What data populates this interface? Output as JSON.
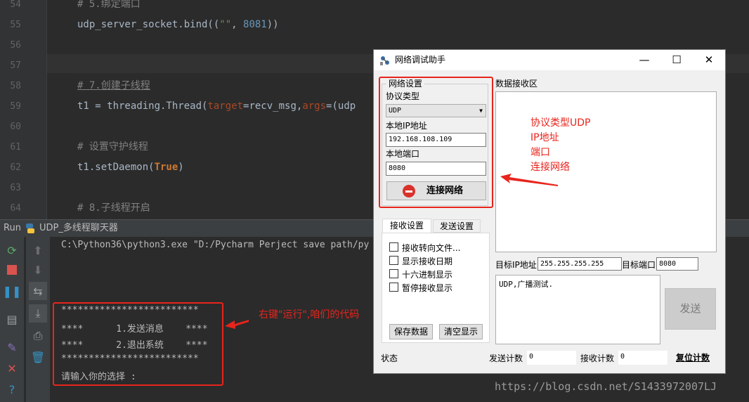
{
  "editor": {
    "lines": [
      {
        "n": "54",
        "text": "# 5.绑定端口"
      },
      {
        "n": "55",
        "text": "udp_server_socket.bind((\"\", 8081))"
      },
      {
        "n": "56",
        "text": ""
      },
      {
        "n": "57",
        "text": ""
      },
      {
        "n": "58",
        "text": "# 7.创建子线程"
      },
      {
        "n": "59",
        "text": "t1 = threading.Thread(target=recv_msg,args=(udp"
      },
      {
        "n": "60",
        "text": ""
      },
      {
        "n": "61",
        "text": "# 设置守护线程"
      },
      {
        "n": "62",
        "text": "t1.setDaemon(True)"
      },
      {
        "n": "63",
        "text": ""
      },
      {
        "n": "64",
        "text": "# 8.子线程开启"
      }
    ]
  },
  "run_panel": {
    "label": "Run",
    "config_name": "UDP_多线程聊天器",
    "command": "C:\\Python36\\python3.exe \"D:/Pycharm Perject save path/py",
    "menu": [
      "*************************",
      "****      1.发送消息    ****",
      "****      2.退出系统    ****",
      "*************************",
      "请输入你的选择 :"
    ],
    "annotation": "右键\"运行\",咱们的代码"
  },
  "net_window": {
    "title": "网络调试助手",
    "controls": {
      "minimize": "—",
      "maximize": "☐",
      "close": "✕"
    },
    "network_settings": {
      "group_title": "网络设置",
      "protocol_label": "协议类型",
      "protocol_value": "UDP",
      "local_ip_label": "本地IP地址",
      "local_ip_value": "192.168.108.109",
      "local_port_label": "本地端口",
      "local_port_value": "8080",
      "connect_button": "连接网络"
    },
    "recv_area_label": "数据接收区",
    "annotation_lines": [
      "协议类型UDP",
      "IP地址",
      "端口",
      "连接网络"
    ],
    "tabs": [
      "接收设置",
      "发送设置"
    ],
    "recv_options": [
      "接收转向文件...",
      "显示接收日期",
      "十六进制显示",
      "暂停接收显示"
    ],
    "save_button": "保存数据",
    "clear_button": "清空显示",
    "target_ip_label": "目标IP地址",
    "target_ip_value": "255.255.255.255",
    "target_port_label": "目标端口",
    "target_port_value": "8080",
    "send_text": "UDP,广播测试.",
    "send_button": "发送",
    "status_label": "状态",
    "send_count_label": "发送计数",
    "send_count_value": "0",
    "recv_count_label": "接收计数",
    "recv_count_value": "0",
    "reset_label": "复位计数"
  },
  "watermark": "https://blog.csdn.net/S1433972007LJ",
  "colors": {
    "annotation_red": "#e8241c",
    "editor_bg": "#2b2b2b"
  }
}
